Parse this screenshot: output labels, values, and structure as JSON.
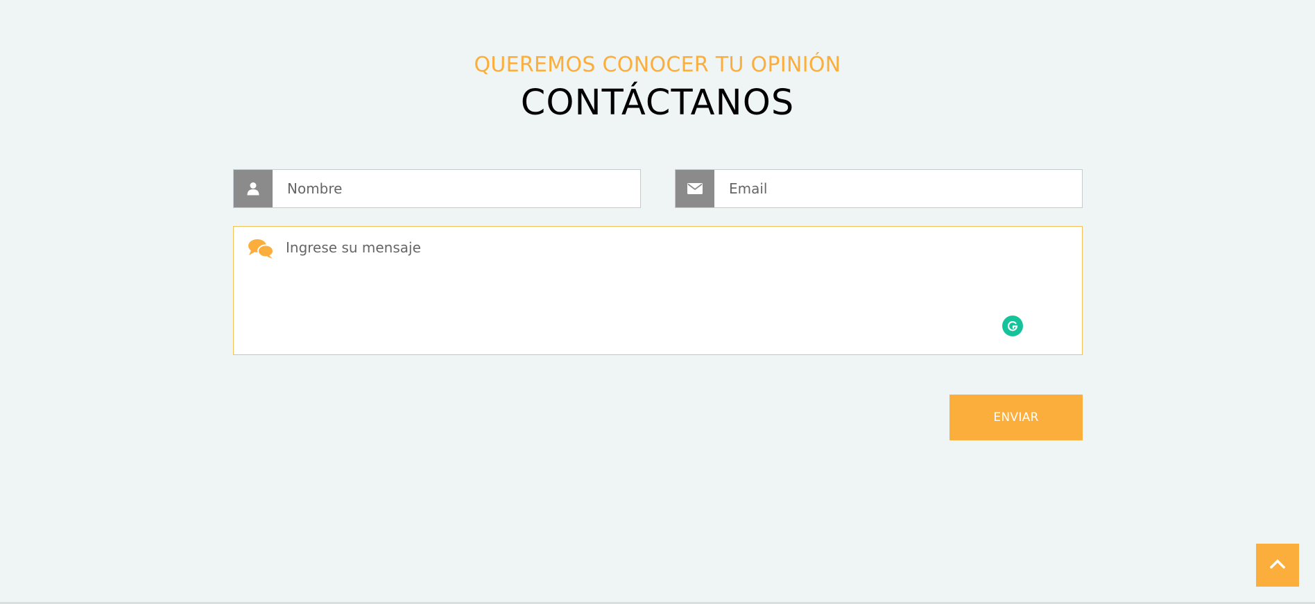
{
  "header": {
    "subtitle": "QUEREMOS CONOCER TU OPINIÓN",
    "title": "CONTÁCTANOS"
  },
  "form": {
    "name": {
      "placeholder": "Nombre",
      "value": "",
      "icon": "user-icon"
    },
    "email": {
      "placeholder": "Email",
      "value": "",
      "icon": "envelope-icon"
    },
    "message": {
      "placeholder": "Ingrese su mensaje",
      "value": "",
      "icon": "chat-bubbles-icon"
    },
    "submit_label": "ENVIAR"
  },
  "extensions": {
    "grammarly_icon": "grammarly-icon"
  },
  "back_to_top_icon": "chevron-up-icon",
  "colors": {
    "background": "#eff4f4",
    "accent": "#fbae3c",
    "icon_box": "#8b8b8b",
    "grammarly": "#15c39a",
    "title": "#000000"
  }
}
